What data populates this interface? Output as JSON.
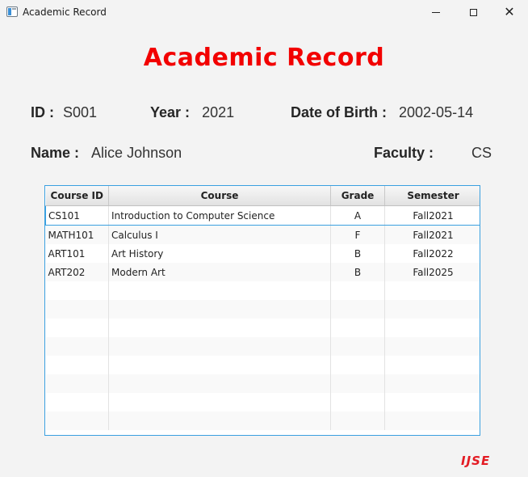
{
  "window": {
    "title": "Academic Record"
  },
  "heading": "Academic Record",
  "info": {
    "id_label": "ID :",
    "id_value": "S001",
    "year_label": "Year :",
    "year_value": "2021",
    "dob_label": "Date of Birth :",
    "dob_value": "2002-05-14",
    "name_label": "Name :",
    "name_value": "Alice Johnson",
    "faculty_label": "Faculty :",
    "faculty_value": "CS"
  },
  "table": {
    "columns": [
      "Course ID",
      "Course",
      "Grade",
      "Semester"
    ],
    "rows": [
      [
        "CS101",
        "Introduction to Computer Science",
        "A",
        "Fall2021"
      ],
      [
        "MATH101",
        "Calculus I",
        "F",
        "Fall2021"
      ],
      [
        "ART101",
        "Art History",
        "B",
        "Fall2022"
      ],
      [
        "ART202",
        "Modern Art",
        "B",
        "Fall2025"
      ]
    ],
    "selected_row": 0
  },
  "logo": "IJSE",
  "colors": {
    "heading": "#f20000",
    "selection": "#3aa0e0",
    "logo": "#e31b23"
  }
}
